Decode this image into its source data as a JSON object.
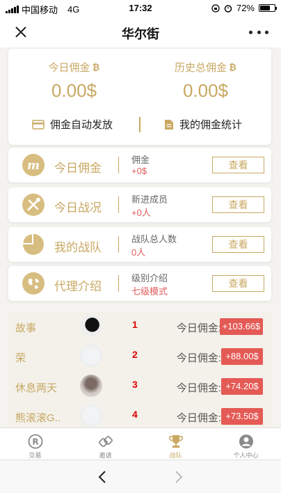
{
  "status_bar": {
    "carrier": "中国移动",
    "network": "4G",
    "time": "17:32",
    "battery": "72%",
    "battery_level": 0.72
  },
  "nav": {
    "title": "华尔街"
  },
  "summary": {
    "today_label": "今日佣金",
    "today_value": "0.00$",
    "total_label": "历史总佣金",
    "total_value": "0.00$",
    "auto_pay_label": "佣金自动发放",
    "stats_label": "我的佣金统计"
  },
  "rows": [
    {
      "title": "今日佣金",
      "sub_label": "佣金",
      "sub_value": "+0$",
      "button": "查看",
      "icon": "m-badge-icon"
    },
    {
      "title": "今日战况",
      "sub_label": "新进成员",
      "sub_value": "+0人",
      "button": "查看",
      "icon": "tools-icon"
    },
    {
      "title": "我的战队",
      "sub_label": "战队总人数",
      "sub_value": "0人",
      "button": "查看",
      "icon": "pie-chart-icon"
    },
    {
      "title": "代理介绍",
      "sub_label": "级别介绍",
      "sub_value": "七级模式",
      "button": "查看",
      "icon": "globe-icon"
    }
  ],
  "leaderboard": [
    {
      "name": "故事",
      "rank": "1",
      "label": "今日佣金:",
      "amount": "+103.66$"
    },
    {
      "name": "荣",
      "rank": "2",
      "label": "今日佣金:",
      "amount": "+88.00$"
    },
    {
      "name": "休息两天",
      "rank": "3",
      "label": "今日佣金:",
      "amount": "+74.20$"
    },
    {
      "name": "熊滚滚G..",
      "rank": "4",
      "label": "今日佣金:",
      "amount": "+73.50$"
    }
  ],
  "tabs": [
    {
      "label": "交易",
      "icon": "registered-icon"
    },
    {
      "label": "邀请",
      "icon": "link-icon"
    },
    {
      "label": "战队",
      "icon": "trophy-icon",
      "active": true
    },
    {
      "label": "个人中心",
      "icon": "user-icon"
    }
  ],
  "colors": {
    "accent_gold": "#c9a863",
    "highlight_red": "#e45a55",
    "rank_red": "#dd0000"
  }
}
